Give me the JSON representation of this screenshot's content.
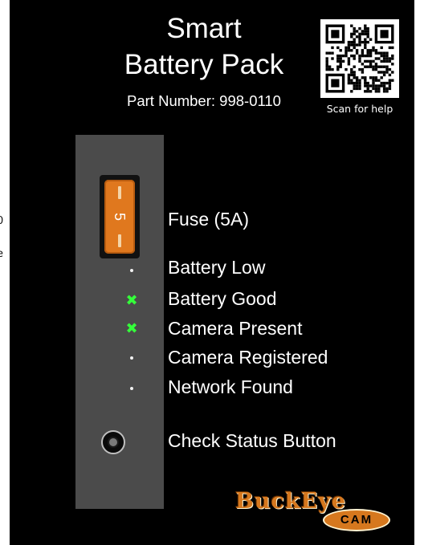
{
  "offscreen": {
    "line_one": "0",
    "line_two": "e"
  },
  "header": {
    "title_line_one": "Smart",
    "title_line_two": "Battery Pack",
    "part_number": "Part Number: 998-0110"
  },
  "qr": {
    "caption": "Scan for help"
  },
  "fuse": {
    "label": "Fuse (5A)",
    "rating_number": "5",
    "color": "#e0781e"
  },
  "leds": [
    {
      "label": "Battery Low",
      "state": "off"
    },
    {
      "label": "Battery Good",
      "state": "on"
    },
    {
      "label": "Camera Present",
      "state": "on"
    },
    {
      "label": "Camera Registered",
      "state": "off"
    },
    {
      "label": "Network Found",
      "state": "off"
    }
  ],
  "led_on_color": "#34ff3a",
  "check_button": {
    "label": "Check Status Button"
  },
  "logo": {
    "brand": "BuckEye",
    "sub": "CAM"
  }
}
